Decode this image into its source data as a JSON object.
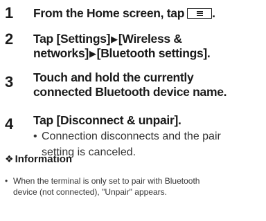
{
  "steps": [
    {
      "number": "1",
      "text_before": "From the Home screen, tap",
      "text_after": ".",
      "icon": "menu-key-icon"
    },
    {
      "number": "2",
      "line1_a": "Tap [Settings]",
      "line1_b": "[Wireless &",
      "line2_a": "networks]",
      "line2_b": "[Bluetooth settings].",
      "separator": "▶"
    },
    {
      "number": "3",
      "line1": "Touch and hold the currently",
      "line2": "connected Bluetooth device name."
    },
    {
      "number": "4",
      "line1": "Tap [Disconnect & unpair].",
      "bullet": "•",
      "note_line1": "Connection disconnects and the pair",
      "note_line2": "setting is canceled."
    }
  ],
  "information": {
    "symbol": "❖",
    "title": "Information",
    "bullet": "•",
    "line1": "When the terminal is only set to pair with Bluetooth",
    "line2": "device (not connected), \"Unpair\" appears."
  }
}
